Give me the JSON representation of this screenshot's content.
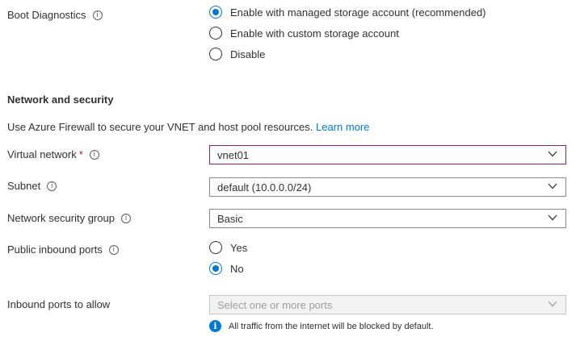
{
  "boot_diagnostics": {
    "label": "Boot Diagnostics",
    "options": [
      {
        "label": "Enable with managed storage account (recommended)",
        "checked": true
      },
      {
        "label": "Enable with custom storage account",
        "checked": false
      },
      {
        "label": "Disable",
        "checked": false
      }
    ]
  },
  "network_security": {
    "heading": "Network and security",
    "description": "Use Azure Firewall to secure your VNET and host pool resources.",
    "learn_more": "Learn more"
  },
  "virtual_network": {
    "label": "Virtual network",
    "required_mark": "*",
    "value": "vnet01"
  },
  "subnet": {
    "label": "Subnet",
    "value": "default (10.0.0.0/24)"
  },
  "nsg": {
    "label": "Network security group",
    "value": "Basic"
  },
  "public_inbound_ports": {
    "label": "Public inbound ports",
    "options": [
      {
        "label": "Yes",
        "checked": false
      },
      {
        "label": "No",
        "checked": true
      }
    ]
  },
  "inbound_ports": {
    "label": "Inbound ports to allow",
    "placeholder": "Select one or more ports",
    "notice": "All traffic from the internet will be blocked by default."
  },
  "colors": {
    "accent": "#0078d4",
    "focus_border": "#8a1f7a",
    "required": "#a4262c"
  },
  "icons": {
    "info": "info-circle-icon",
    "chevron": "chevron-down-icon",
    "notice": "info-filled-icon"
  }
}
